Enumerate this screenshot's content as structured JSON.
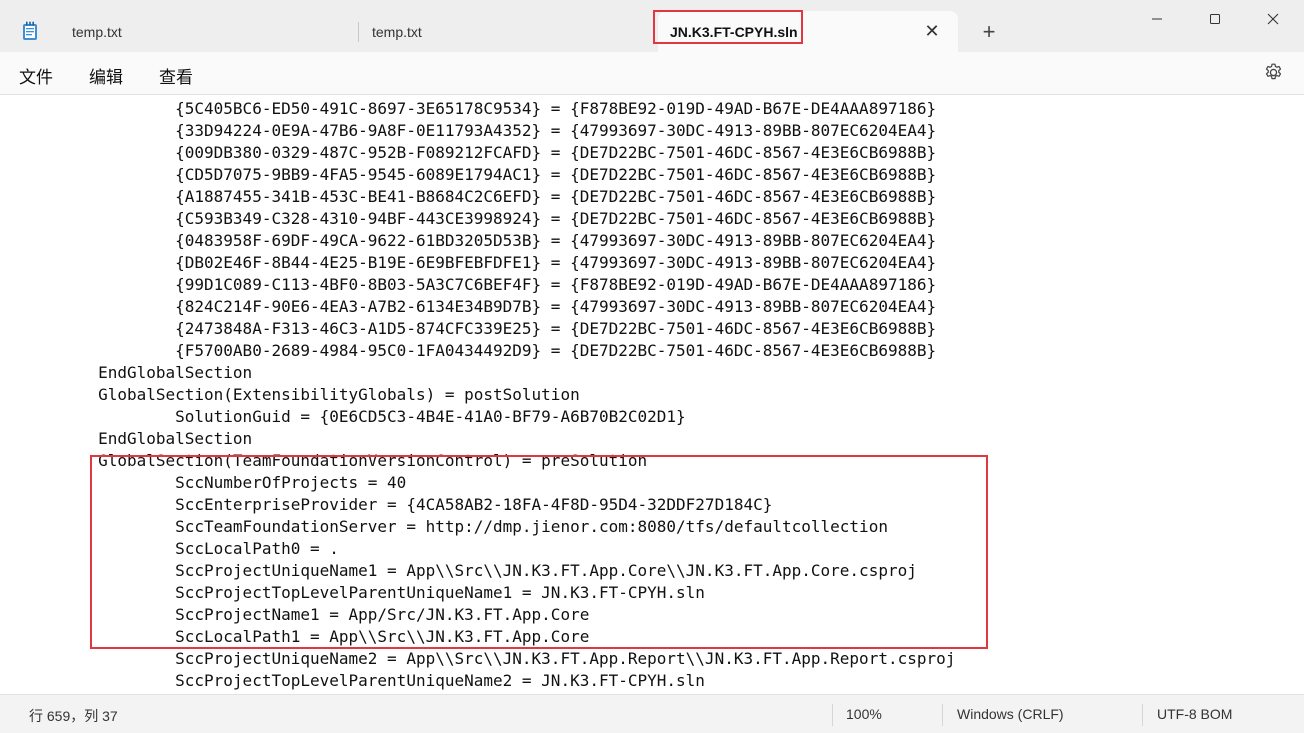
{
  "tabs": [
    {
      "label": "temp.txt",
      "active": false
    },
    {
      "label": "temp.txt",
      "active": false
    },
    {
      "label": "JN.K3.FT-CPYH.sln",
      "active": true
    }
  ],
  "menu": {
    "file": "文件",
    "edit": "编辑",
    "view": "查看"
  },
  "editor": {
    "lines": [
      "\t\t{5C405BC6-ED50-491C-8697-3E65178C9534} = {F878BE92-019D-49AD-B67E-DE4AAA897186}",
      "\t\t{33D94224-0E9A-47B6-9A8F-0E11793A4352} = {47993697-30DC-4913-89BB-807EC6204EA4}",
      "\t\t{009DB380-0329-487C-952B-F089212FCAFD} = {DE7D22BC-7501-46DC-8567-4E3E6CB6988B}",
      "\t\t{CD5D7075-9BB9-4FA5-9545-6089E1794AC1} = {DE7D22BC-7501-46DC-8567-4E3E6CB6988B}",
      "\t\t{A1887455-341B-453C-BE41-B8684C2C6EFD} = {DE7D22BC-7501-46DC-8567-4E3E6CB6988B}",
      "\t\t{C593B349-C328-4310-94BF-443CE3998924} = {DE7D22BC-7501-46DC-8567-4E3E6CB6988B}",
      "\t\t{0483958F-69DF-49CA-9622-61BD3205D53B} = {47993697-30DC-4913-89BB-807EC6204EA4}",
      "\t\t{DB02E46F-8B44-4E25-B19E-6E9BFEBFDFE1} = {47993697-30DC-4913-89BB-807EC6204EA4}",
      "\t\t{99D1C089-C113-4BF0-8B03-5A3C7C6BEF4F} = {F878BE92-019D-49AD-B67E-DE4AAA897186}",
      "\t\t{824C214F-90E6-4EA3-A7B2-6134E34B9D7B} = {47993697-30DC-4913-89BB-807EC6204EA4}",
      "\t\t{2473848A-F313-46C3-A1D5-874CFC339E25} = {DE7D22BC-7501-46DC-8567-4E3E6CB6988B}",
      "\t\t{F5700AB0-2689-4984-95C0-1FA0434492D9} = {DE7D22BC-7501-46DC-8567-4E3E6CB6988B}",
      "\tEndGlobalSection",
      "\tGlobalSection(ExtensibilityGlobals) = postSolution",
      "\t\tSolutionGuid = {0E6CD5C3-4B4E-41A0-BF79-A6B70B2C02D1}",
      "\tEndGlobalSection",
      "\tGlobalSection(TeamFoundationVersionControl) = preSolution",
      "\t\tSccNumberOfProjects = 40",
      "\t\tSccEnterpriseProvider = {4CA58AB2-18FA-4F8D-95D4-32DDF27D184C}",
      "\t\tSccTeamFoundationServer = http://dmp.jienor.com:8080/tfs/defaultcollection",
      "\t\tSccLocalPath0 = .",
      "\t\tSccProjectUniqueName1 = App\\\\Src\\\\JN.K3.FT.App.Core\\\\JN.K3.FT.App.Core.csproj",
      "\t\tSccProjectTopLevelParentUniqueName1 = JN.K3.FT-CPYH.sln",
      "\t\tSccProjectName1 = App/Src/JN.K3.FT.App.Core",
      "\t\tSccLocalPath1 = App\\\\Src\\\\JN.K3.FT.App.Core",
      "\t\tSccProjectUniqueName2 = App\\\\Src\\\\JN.K3.FT.App.Report\\\\JN.K3.FT.App.Report.csproj",
      "\t\tSccProjectTopLevelParentUniqueName2 = JN.K3.FT-CPYH.sln"
    ]
  },
  "status": {
    "position": "行 659，列 37",
    "zoom": "100%",
    "line_ending": "Windows (CRLF)",
    "encoding": "UTF-8 BOM"
  },
  "colors": {
    "highlight": "#e0383e",
    "accent": "#0067c0"
  },
  "icons": {
    "app": "notepad-icon",
    "tab_close": "close-icon",
    "new_tab": "plus-icon",
    "minimize": "minimize-icon",
    "maximize": "maximize-icon",
    "close_window": "close-icon",
    "settings": "gear-icon"
  }
}
